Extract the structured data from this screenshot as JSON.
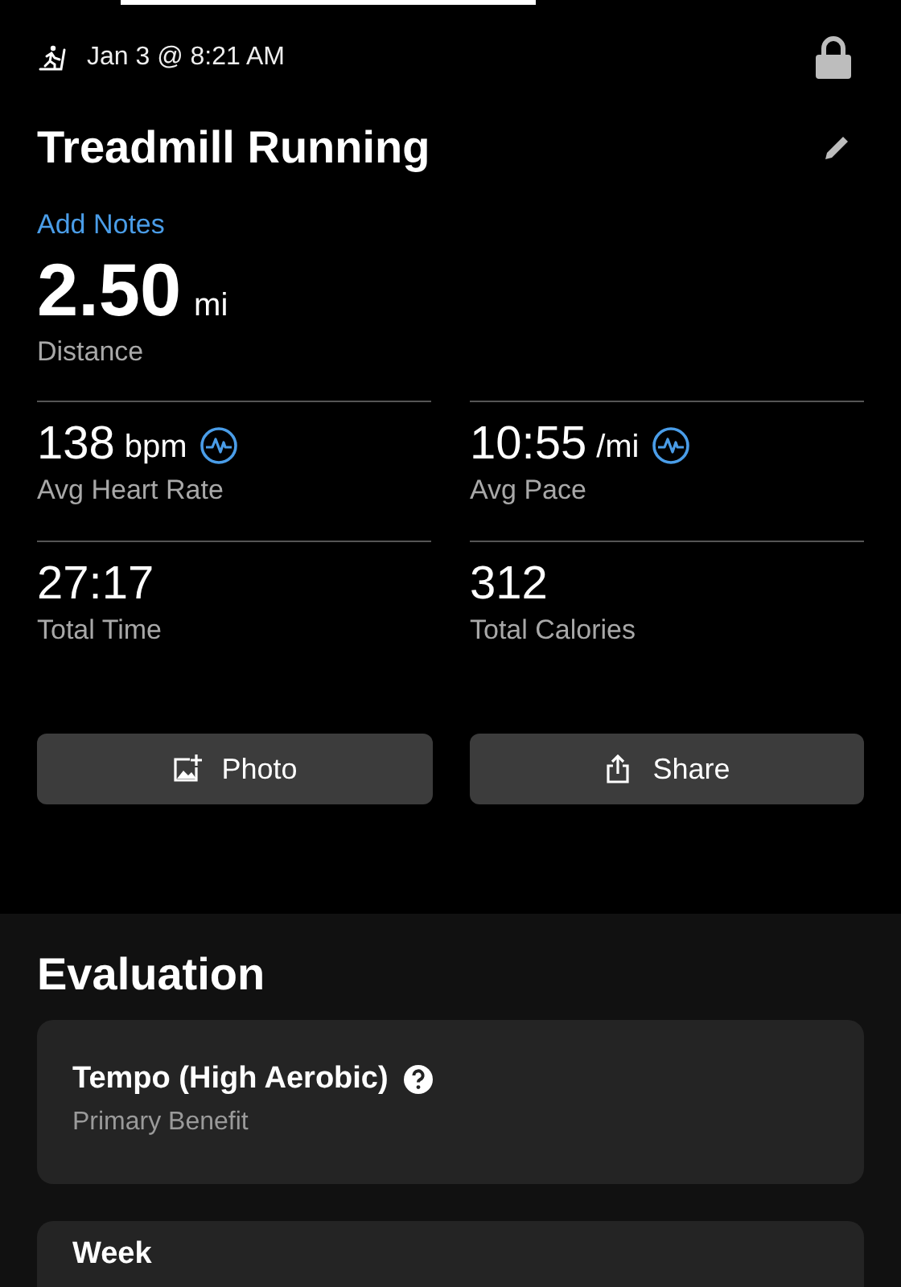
{
  "header": {
    "date": "Jan 3 @ 8:21 AM",
    "locked": true
  },
  "activity": {
    "title": "Treadmill Running",
    "notes_link": "Add Notes"
  },
  "distance": {
    "value": "2.50",
    "unit": "mi",
    "label": "Distance"
  },
  "stats": [
    {
      "value": "138",
      "unit": "bpm",
      "label": "Avg Heart Rate",
      "chart_icon": true
    },
    {
      "value": "10:55",
      "unit": "/mi",
      "label": "Avg Pace",
      "chart_icon": true
    },
    {
      "value": "27:17",
      "label": "Total Time",
      "chart_icon": false
    },
    {
      "value": "312",
      "label": "Total Calories",
      "chart_icon": false
    }
  ],
  "buttons": [
    {
      "kind": "photo",
      "label": "Photo"
    },
    {
      "kind": "share",
      "label": "Share"
    }
  ],
  "evaluation": {
    "title": "Evaluation",
    "cards": [
      {
        "title": "Tempo (High Aerobic)",
        "subtitle": "Primary Benefit",
        "help": true
      },
      {
        "title": "Week"
      }
    ]
  }
}
